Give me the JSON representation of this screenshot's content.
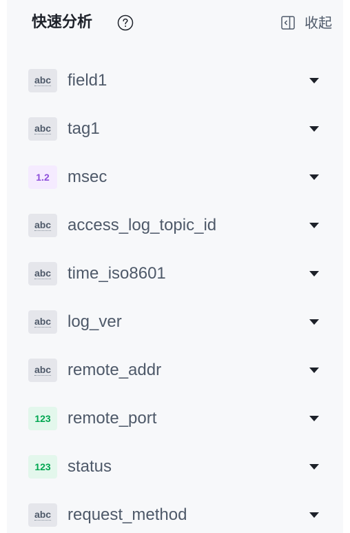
{
  "header": {
    "title": "快速分析",
    "collapse_label": "收起"
  },
  "fields": [
    {
      "name": "field1",
      "type_label": "abc",
      "type": "text"
    },
    {
      "name": "tag1",
      "type_label": "abc",
      "type": "text"
    },
    {
      "name": "msec",
      "type_label": "1.2",
      "type": "float"
    },
    {
      "name": "access_log_topic_id",
      "type_label": "abc",
      "type": "text"
    },
    {
      "name": "time_iso8601",
      "type_label": "abc",
      "type": "text"
    },
    {
      "name": "log_ver",
      "type_label": "abc",
      "type": "text"
    },
    {
      "name": "remote_addr",
      "type_label": "abc",
      "type": "text"
    },
    {
      "name": "remote_port",
      "type_label": "123",
      "type": "int"
    },
    {
      "name": "status",
      "type_label": "123",
      "type": "int"
    },
    {
      "name": "request_method",
      "type_label": "abc",
      "type": "text"
    }
  ],
  "icons": {
    "help": "help-circle-icon",
    "collapse": "collapse-panel-icon",
    "expand": "caret-down-icon"
  },
  "colors": {
    "panel_bg": "#f7f8fa",
    "text_badge_bg": "#e5e6eb",
    "float_badge_color": "#8d4eda",
    "int_badge_color": "#00a650"
  }
}
